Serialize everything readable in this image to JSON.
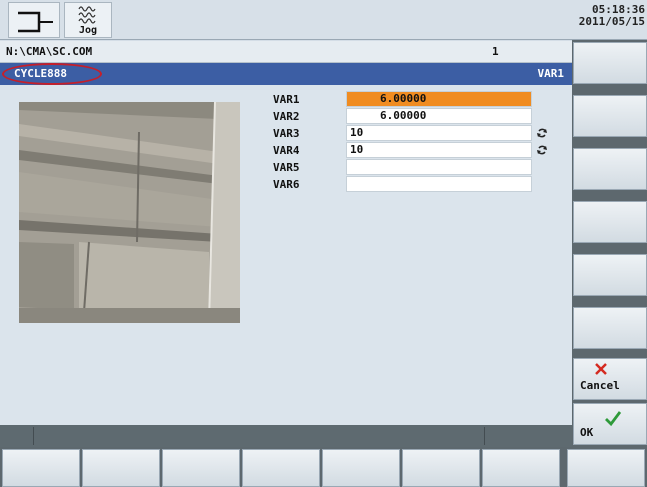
{
  "header": {
    "jog_label": "Jog",
    "time": "05:18:36",
    "date": "2011/05/15"
  },
  "path_row": {
    "program_path": "N:\\CMA\\SC.COM",
    "channel": "1"
  },
  "title_bar": {
    "cycle_name": "CYCLE888",
    "current_var": "VAR1"
  },
  "params": [
    {
      "label": "VAR1",
      "value": "6.00000",
      "active": true
    },
    {
      "label": "VAR2",
      "value": "6.00000",
      "active": false
    },
    {
      "label": "VAR3",
      "value": "10",
      "toggle": true
    },
    {
      "label": "VAR4",
      "value": "10",
      "toggle": true
    },
    {
      "label": "VAR5",
      "value": ""
    },
    {
      "label": "VAR6",
      "value": ""
    }
  ],
  "softkeys": {
    "cancel_label": "Cancel",
    "ok_label": "OK"
  },
  "colors": {
    "active_field": "#f08c21",
    "title_bar": "#3c5ea4",
    "cancel_x": "#d42a20",
    "ok_check": "#2e9a3a"
  }
}
